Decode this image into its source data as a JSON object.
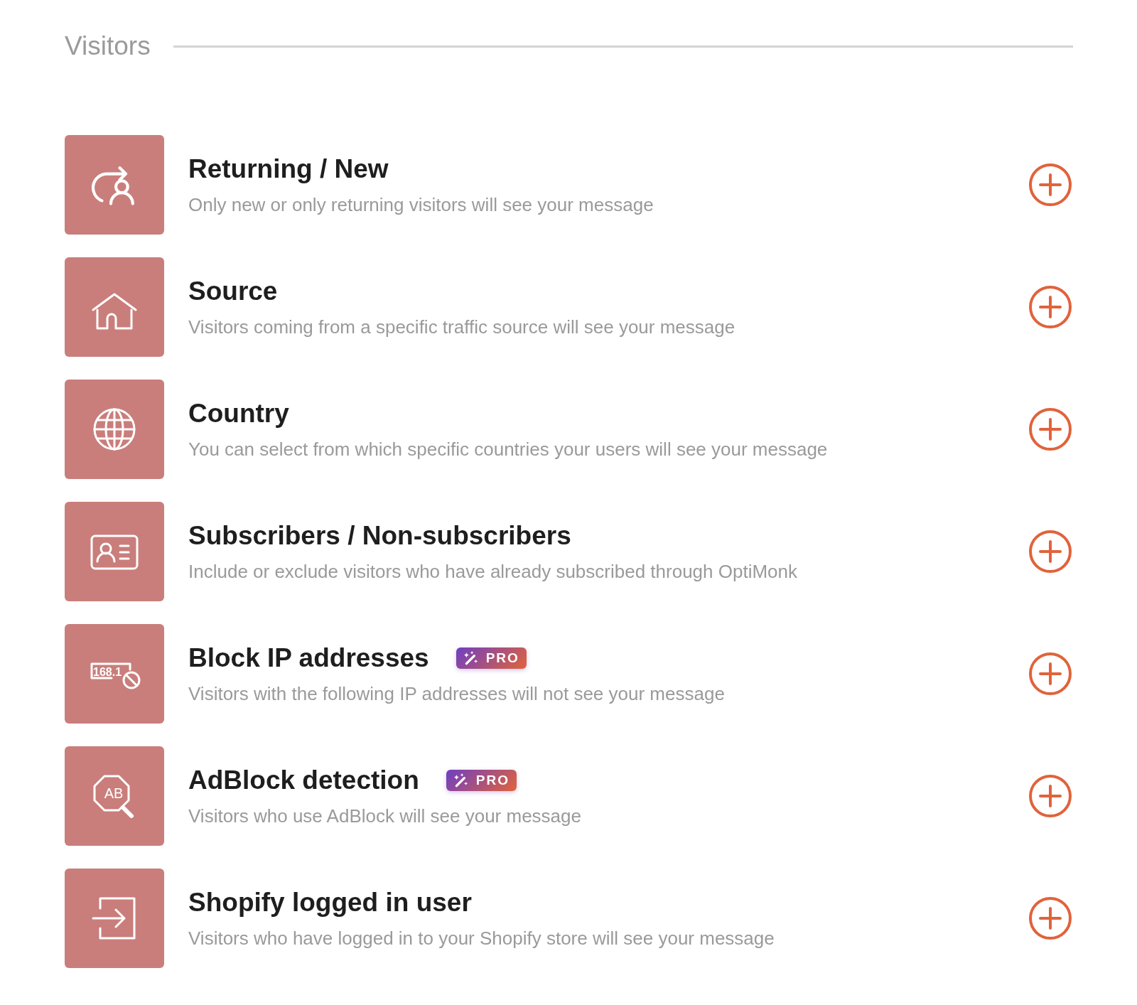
{
  "section": {
    "title": "Visitors"
  },
  "items": [
    {
      "kind": "returning",
      "title": "Returning / New",
      "description": "Only new or only returning visitors will see your message"
    },
    {
      "kind": "source",
      "title": "Source",
      "description": "Visitors coming from a specific traffic source will see your message"
    },
    {
      "kind": "country",
      "title": "Country",
      "description": "You can select from which specific countries your users will see your message"
    },
    {
      "kind": "subscribers",
      "title": "Subscribers / Non-subscribers",
      "description": "Include or exclude visitors who have already subscribed through OptiMonk"
    },
    {
      "kind": "ip",
      "icon_label": "168.1",
      "title": "Block IP addresses",
      "description": "Visitors with the following IP addresses will not see your message",
      "badge": "PRO"
    },
    {
      "kind": "adblock",
      "icon_label": "AB",
      "title": "AdBlock detection",
      "description": "Visitors who use AdBlock will see your message",
      "badge": "PRO"
    },
    {
      "kind": "login",
      "title": "Shopify logged in user",
      "description": "Visitors who have logged in to your Shopify store will see your message"
    }
  ]
}
